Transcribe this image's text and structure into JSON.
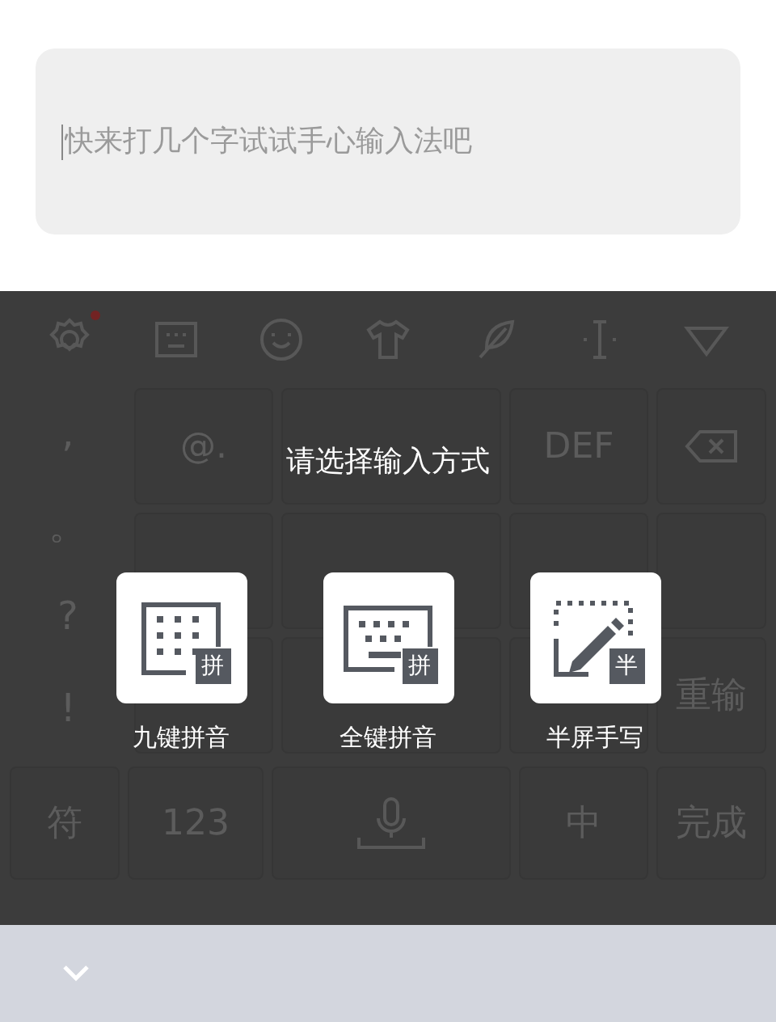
{
  "input": {
    "placeholder": "快来打几个字试试手心输入法吧"
  },
  "keyboard": {
    "side_keys": [
      {
        "label": ","
      },
      {
        "label": "。"
      },
      {
        "label": "?"
      },
      {
        "label": "!"
      }
    ],
    "grid_keys": [
      {
        "kind": "text",
        "label": "@."
      },
      {
        "kind": "blank"
      },
      {
        "kind": "text",
        "label": "DEF"
      },
      {
        "kind": "blank"
      },
      {
        "kind": "blank"
      },
      {
        "kind": "blank"
      },
      {
        "kind": "blank"
      },
      {
        "kind": "blank"
      },
      {
        "kind": "blank"
      }
    ],
    "right_keys": [
      {
        "kind": "backspace"
      },
      {
        "kind": "blank"
      },
      {
        "kind": "text",
        "label": "重输"
      }
    ],
    "bottom_keys": [
      {
        "kind": "text",
        "label": "符"
      },
      {
        "kind": "text",
        "label": "123"
      },
      {
        "kind": "mic"
      },
      {
        "kind": "text",
        "label": "中"
      },
      {
        "kind": "text",
        "label": "完成"
      }
    ]
  },
  "dialog": {
    "title": "请选择输入方式",
    "options": [
      {
        "kind": "nine",
        "badge": "拼",
        "label": "九键拼音"
      },
      {
        "kind": "full",
        "badge": "拼",
        "label": "全键拼音"
      },
      {
        "kind": "hand",
        "badge": "半",
        "label": "半屏手写"
      }
    ]
  }
}
